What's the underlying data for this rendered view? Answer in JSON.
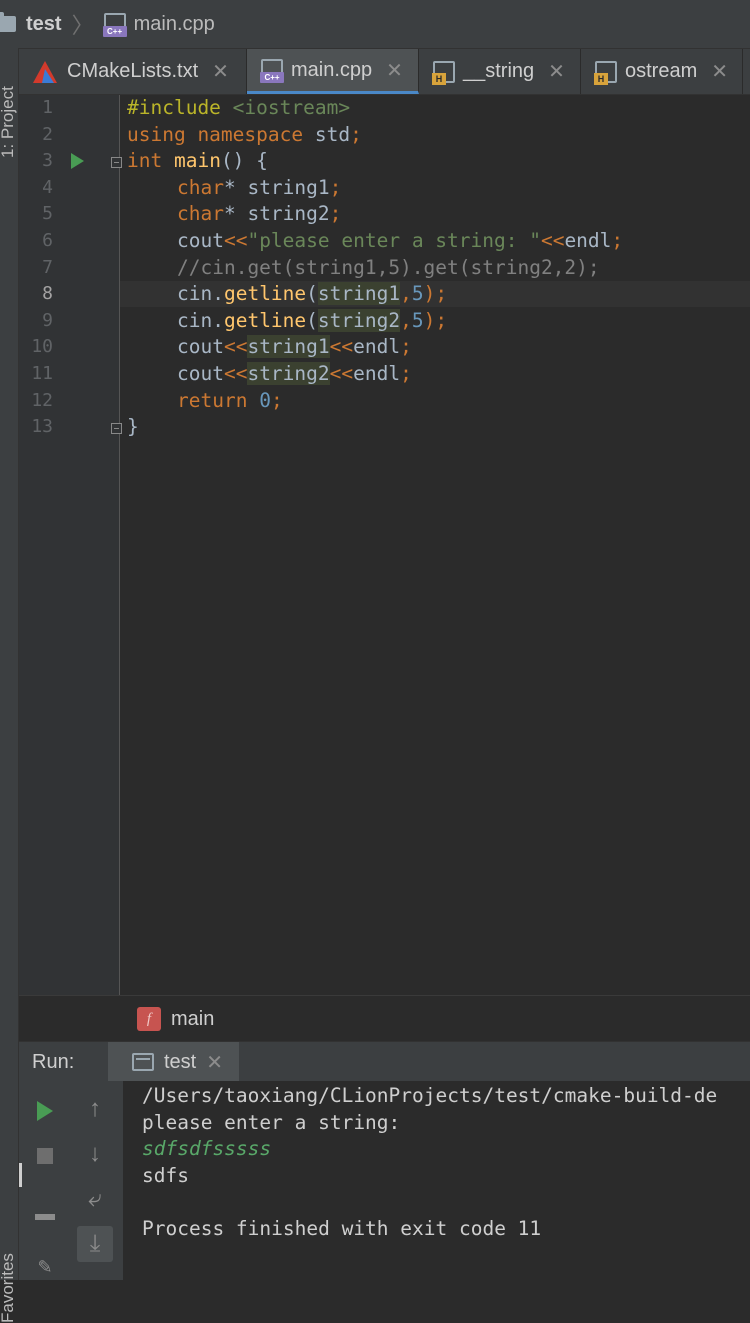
{
  "breadcrumb": {
    "project": "test",
    "file": "main.cpp"
  },
  "side_labels": {
    "project": "1: Project",
    "favorites": "Favorites"
  },
  "tabs": [
    {
      "label": "CMakeLists.txt",
      "icon": "cmake-icon",
      "active": false
    },
    {
      "label": "main.cpp",
      "icon": "cpp-file-icon",
      "active": true
    },
    {
      "label": "__string",
      "icon": "header-file-icon",
      "active": false
    },
    {
      "label": "ostream",
      "icon": "header-file-icon",
      "active": false
    }
  ],
  "tab_close_glyph": "✕",
  "icon_badges": {
    "cpp": "C++",
    "header": "H"
  },
  "editor": {
    "line_numbers": [
      "1",
      "2",
      "3",
      "4",
      "5",
      "6",
      "7",
      "8",
      "9",
      "10",
      "11",
      "12",
      "13"
    ],
    "current_line": "8",
    "code": {
      "l1_include": "#include",
      "l1_header": " <iostream>",
      "l2_using": "using namespace",
      "l2_std": " std",
      "l2_semi": ";",
      "l3_int": "int",
      "l3_main": " main",
      "l3_rest": "() {",
      "l4_char": "char",
      "l4_rest": "* string1",
      "l5_char": "char",
      "l5_rest": "* string2",
      "l6_cout": "cout",
      "l6_op": "<<",
      "l6_str": "\"please enter a string: \"",
      "l6_op2": "<<",
      "l6_endl": "endl",
      "l7_comment": "//cin.get(string1,5).get(string2,2);",
      "l8_cin": "cin.",
      "l8_fn": "getline",
      "l8_open": "(",
      "l8_arg": "string1",
      "l8_comma": ",",
      "l8_num": "5",
      "l8_close": ");",
      "l9_cin": "cin.",
      "l9_fn": "getline",
      "l9_open": "(",
      "l9_arg": "string2",
      "l9_comma": ",",
      "l9_num": "5",
      "l9_close": ");",
      "l10_cout": "cout",
      "l10_op": "<<",
      "l10_arg": "string1",
      "l10_op2": "<<",
      "l10_endl": "endl",
      "l11_cout": "cout",
      "l11_op": "<<",
      "l11_arg": "string2",
      "l11_op2": "<<",
      "l11_endl": "endl",
      "l12_return": "return",
      "l12_num": " 0",
      "l13_brace": "}"
    }
  },
  "structure": {
    "badge": "f",
    "label": "main"
  },
  "run": {
    "panel_label": "Run:",
    "tab_label": "test",
    "console": [
      "/Users/taoxiang/CLionProjects/test/cmake-build-de",
      "please enter a string:",
      "sdfsdfsssss",
      "sdfs",
      "",
      "Process finished with exit code 11"
    ]
  },
  "colors": {
    "accent": "#4a88c7",
    "keyword": "#cc7832",
    "string": "#6a8759",
    "number": "#6897bb",
    "function": "#ffc66d",
    "run": "#499c54"
  }
}
